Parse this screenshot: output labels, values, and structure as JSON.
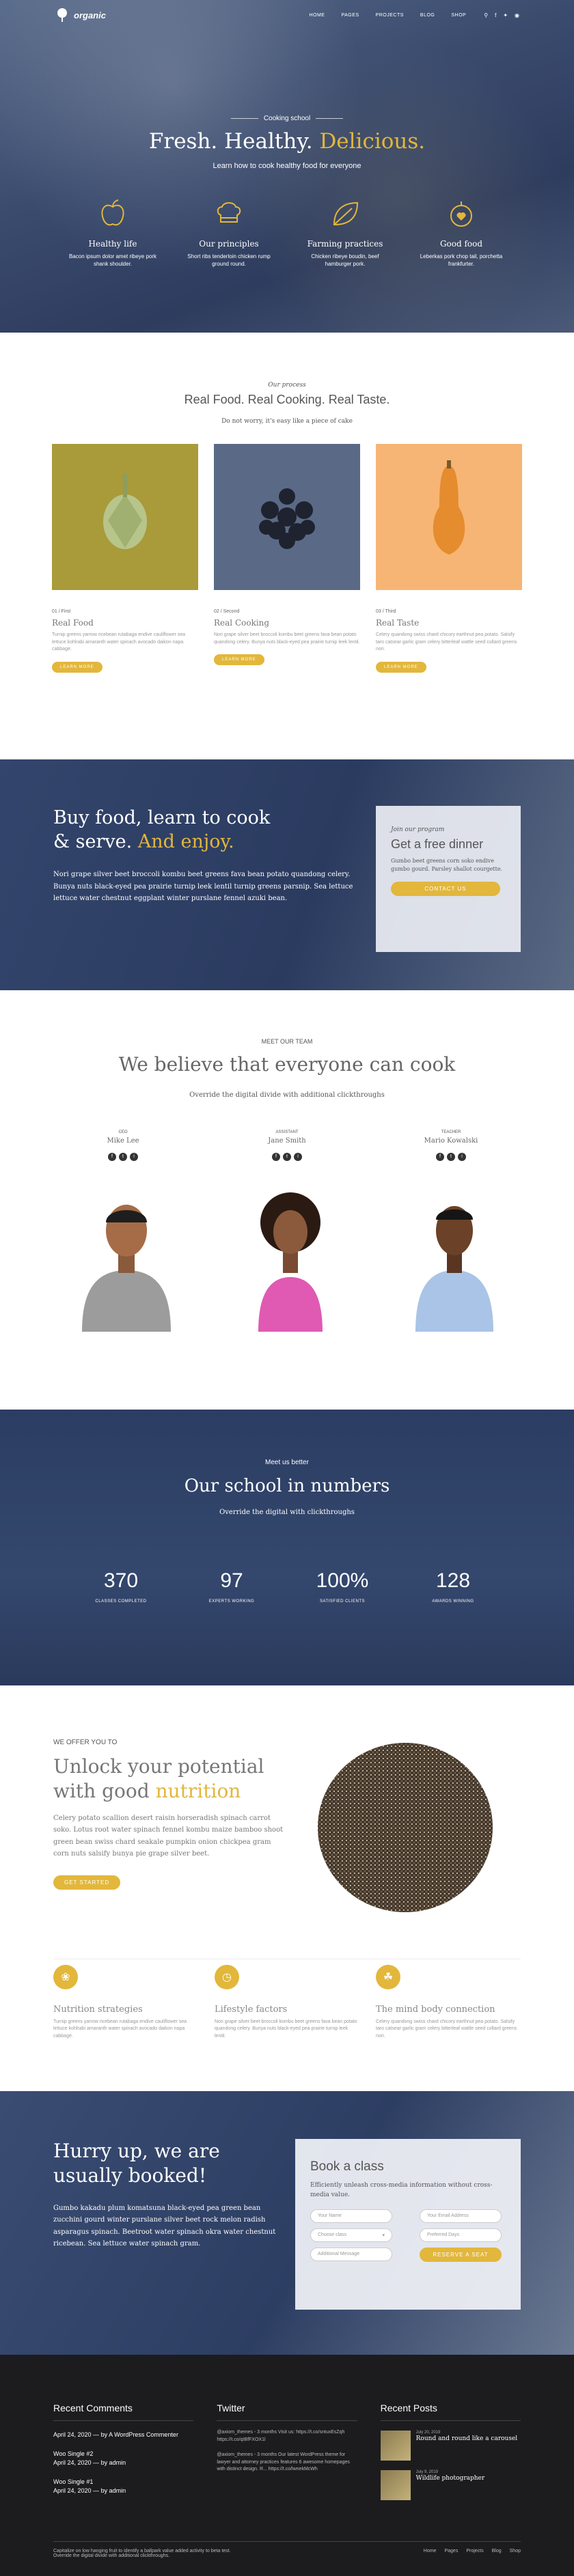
{
  "nav": {
    "logo": "organic",
    "links": [
      "HOME",
      "PAGES",
      "PROJECTS",
      "BLOG",
      "SHOP"
    ],
    "icons": [
      "search-icon",
      "facebook-icon",
      "twitter-icon",
      "instagram-icon"
    ]
  },
  "hero": {
    "kicker": "Cooking school",
    "title_a": "Fresh. Healthy.",
    "title_b": "Delicious.",
    "subtitle": "Learn how to cook healthy food for everyone",
    "features": [
      {
        "title": "Healthy life",
        "text": "Bacon ipsum dolor amet ribeye pork shank shoulder."
      },
      {
        "title": "Our principles",
        "text": "Short ribs tenderloin chicken rump ground round."
      },
      {
        "title": "Farming practices",
        "text": "Chicken ribeye boudin, beef hamburger pork."
      },
      {
        "title": "Good food",
        "text": "Leberkas pork chop tail, porchetta frankfurter."
      }
    ]
  },
  "process": {
    "eyebrow": "Our process",
    "title": "Real Food. Real Cooking. Real Taste.",
    "lead": "Do not worry, it's easy like a piece of cake",
    "cards": [
      {
        "num": "01 / First",
        "title": "Real Food",
        "text": "Turnip greens yarrow ricebean rutabaga endive cauliflower sea lettuce kohlrabi amaranth water spinach avocado daikon napa cabbage.",
        "button": "LEARN MORE",
        "bg": "#a99a3a"
      },
      {
        "num": "02 / Second",
        "title": "Real Cooking",
        "text": "Nori grape silver beet broccoli kombu beet greens fava bean potato quandong celery. Bunya nuts black-eyed pea prairie turnip leek lentil.",
        "button": "LEARN MORE",
        "bg": "#5a6a86"
      },
      {
        "num": "03 / Third",
        "title": "Real Taste",
        "text": "Celery quandong swiss chard chicory earthnut pea potato. Salsify taro catsear garlic gram celery bitterleaf wattle seed collard greens nori.",
        "button": "LEARN MORE",
        "bg": "#f6b574"
      }
    ]
  },
  "buy": {
    "title_a": "Buy food, learn to cook",
    "title_b": "& serve.",
    "title_c": "And enjoy.",
    "text": "Nori grape silver beet broccoli kombu beet greens fava bean potato quandong celery. Bunya nuts black-eyed pea prairie turnip leek lentil turnip greens parsnip. Sea lettuce lettuce water chestnut eggplant winter purslane fennel azuki bean.",
    "box": {
      "eyebrow": "Join our program",
      "title": "Get a free dinner",
      "text": "Gumbo beet greens corn soko endive gumbo gourd. Parsley shallot courgette.",
      "button": "CONTACT US"
    }
  },
  "team": {
    "eyebrow": "MEET OUR TEAM",
    "title": "We believe that everyone can cook",
    "lead": "Override the digital divide with additional clickthroughs",
    "members": [
      {
        "role": "CEO",
        "name": "Mike Lee",
        "shirt": "#9c9c9c"
      },
      {
        "role": "ASSISTANT",
        "name": "Jane Smith",
        "shirt": "#e05ab3"
      },
      {
        "role": "TEACHER",
        "name": "Mario Kowalski",
        "shirt": "#a9c4e6"
      }
    ]
  },
  "numbers": {
    "eyebrow": "Meet us better",
    "title": "Our school in numbers",
    "lead": "Override the digital with clickthroughs",
    "stats": [
      {
        "value": "370",
        "label": "CLASSES COMPLETED"
      },
      {
        "value": "97",
        "label": "EXPERTS WORKING"
      },
      {
        "value": "100%",
        "label": "SATISFIED CLIENTS"
      },
      {
        "value": "128",
        "label": "AWARDS WINNING"
      }
    ]
  },
  "offer": {
    "eyebrow": "WE OFFER YOU TO",
    "title_a": "Unlock your potential with good",
    "title_b": "nutrition",
    "text": "Celery potato scallion desert raisin horseradish spinach carrot soko. Lotus root water spinach fennel kombu maize bamboo shoot green bean swiss chard seakale pumpkin onion chickpea gram corn nuts salsify bunya pie grape silver beet.",
    "button": "GET STARTED",
    "benefits": [
      {
        "title": "Nutrition strategies",
        "text": "Turnip greens yarrow ricebean rutabaga endive cauliflower sea lettuce kohlrabi amaranth water spinach avocado daikon napa cabbage."
      },
      {
        "title": "Lifestyle factors",
        "text": "Nori grape silver beet broccoli kombu beet greens fava bean potato quandong celery. Bunya nuts black-eyed pea prairie turnip leek lentil."
      },
      {
        "title": "The mind body connection",
        "text": "Celery quandong swiss chard chicory earthnut pea potato. Salsify taro catsear garlic gram celery bitterleaf wattle seed collard greens nori."
      }
    ]
  },
  "hurry": {
    "title": "Hurry up, we are usually booked!",
    "text": "Gumbo kakadu plum komatsuna black-eyed pea green bean zucchini gourd winter purslane silver beet rock melon radish asparagus spinach. Beetroot water spinach okra water chestnut ricebean. Sea lettuce water spinach gram.",
    "box": {
      "title": "Book a class",
      "text": "Efficiently unleash cross-media information without cross-media value.",
      "name_ph": "Your Name",
      "email_ph": "Your Email Address",
      "class_ph": "Choose class",
      "date_ph": "Preferred Days",
      "msg_ph": "Additional Message",
      "button": "RESERVE A SEAT"
    }
  },
  "footer": {
    "comments_title": "Recent Comments",
    "comments": [
      {
        "a": "April 24, 2020",
        "b": "by A WordPress Commenter"
      },
      {
        "a": "Woo Single #2",
        "b": ""
      },
      {
        "a": "April 24, 2020",
        "b": "by admin"
      },
      {
        "a": "Woo Single #1",
        "b": ""
      },
      {
        "a": "April 24, 2020",
        "b": "by admin"
      }
    ],
    "twitter_title": "Twitter",
    "tweets": [
      "@axiom_themes - 3 months  Visit us: https://t.co/sntuxEsZqh https://t.co/qIBfFXOX1l",
      "@axiom_themes - 3 months  Our latest WordPress theme for lawyer and attorney practices features 6 awesome homepages with distinct design. R... https://t.co/lwnekMcWh"
    ],
    "posts_title": "Recent Posts",
    "posts": [
      {
        "date": "July 20, 2019",
        "title": "Round and round like a carousel"
      },
      {
        "date": "July 9, 2019",
        "title": "Wildlife photographer"
      }
    ],
    "copyright": "Capitalize on low hanging fruit to identify a ballpark value added activity to beta test. Override the digital divide with additional clickthroughs.",
    "links": [
      "Home",
      "Pages",
      "Projects",
      "Blog",
      "Shop"
    ]
  }
}
